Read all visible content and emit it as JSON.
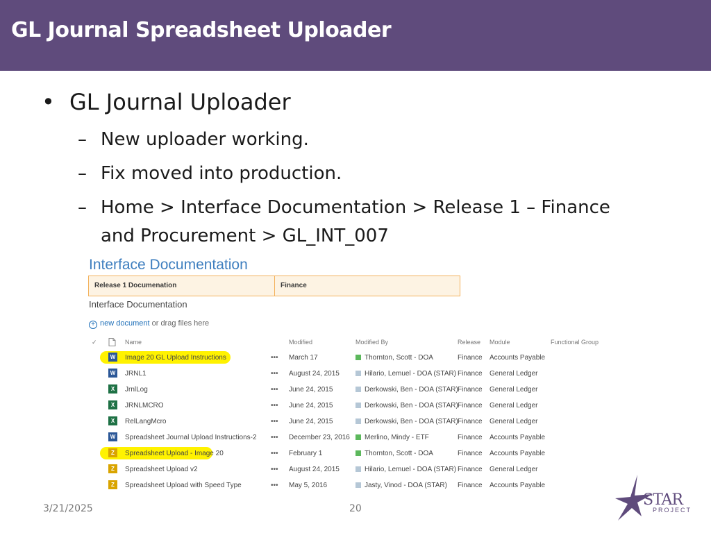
{
  "slide": {
    "title": "GL Journal Spreadsheet Uploader",
    "bullet": "GL Journal Uploader",
    "bullet_glyph": "•",
    "dash_glyph": "–",
    "sub_items": [
      "New uploader working.",
      "Fix moved into production.",
      "Home > Interface Documentation > Release 1 – Finance",
      "and Procurement > GL_INT_007"
    ],
    "footer_date": "3/21/2025",
    "page_number": "20",
    "logo_text": "STAR",
    "logo_sub": "PROJECT"
  },
  "screenshot": {
    "title": "Interface Documentation",
    "tabs": [
      "Release 1 Documenation",
      "Finance"
    ],
    "subtitle": "Interface Documentation",
    "new_document_link": "new document",
    "new_document_suffix": " or drag files here",
    "columns": [
      "Name",
      "Modified",
      "Modified By",
      "Release",
      "Module",
      "Functional Group"
    ],
    "ellipsis": "•••",
    "rows": [
      {
        "name": "Image 20 GL Upload Instructions",
        "modified": "March 17",
        "modified_by": "Thornton, Scott - DOA",
        "release": "Finance",
        "module": "Accounts Payable",
        "icon": "word-doc-icon",
        "highlight": true
      },
      {
        "name": "JRNL1",
        "modified": "August 24, 2015",
        "modified_by": "Hilario, Lemuel - DOA (STAR)",
        "release": "Finance",
        "module": "General Ledger",
        "icon": "word-doc-icon",
        "highlight": false
      },
      {
        "name": "JrnlLog",
        "modified": "June 24, 2015",
        "modified_by": "Derkowski, Ben - DOA (STAR)",
        "release": "Finance",
        "module": "General Ledger",
        "icon": "excel-doc-icon",
        "highlight": false
      },
      {
        "name": "JRNLMCRO",
        "modified": "June 24, 2015",
        "modified_by": "Derkowski, Ben - DOA (STAR)",
        "release": "Finance",
        "module": "General Ledger",
        "icon": "excel-doc-icon",
        "highlight": false
      },
      {
        "name": "RelLangMcro",
        "modified": "June 24, 2015",
        "modified_by": "Derkowski, Ben - DOA (STAR)",
        "release": "Finance",
        "module": "General Ledger",
        "icon": "excel-doc-icon",
        "highlight": false
      },
      {
        "name": "Spreadsheet Journal Upload Instructions-2",
        "modified": "December 23, 2016",
        "modified_by": "Merlino, Mindy - ETF",
        "release": "Finance",
        "module": "Accounts Payable",
        "icon": "word-doc-icon",
        "highlight": false
      },
      {
        "name": "Spreadsheet Upload - Image 20",
        "modified": "February 1",
        "modified_by": "Thornton, Scott - DOA",
        "release": "Finance",
        "module": "Accounts Payable",
        "icon": "zip-folder-icon",
        "highlight": true
      },
      {
        "name": "Spreadsheet Upload v2",
        "modified": "August 24, 2015",
        "modified_by": "Hilario, Lemuel - DOA (STAR)",
        "release": "Finance",
        "module": "General Ledger",
        "icon": "zip-folder-icon",
        "highlight": false
      },
      {
        "name": "Spreadsheet Upload with Speed Type",
        "modified": "May 5, 2016",
        "modified_by": "Jasty, Vinod - DOA (STAR)",
        "release": "Finance",
        "module": "Accounts Payable",
        "icon": "zip-folder-icon",
        "highlight": false
      }
    ],
    "colors": {
      "banner": "#5f4b7c",
      "presence_online": "#5cb85c",
      "presence_offline": "#b5c7d6",
      "highlight": "#fff200",
      "tab_border": "#f3b15a"
    }
  }
}
